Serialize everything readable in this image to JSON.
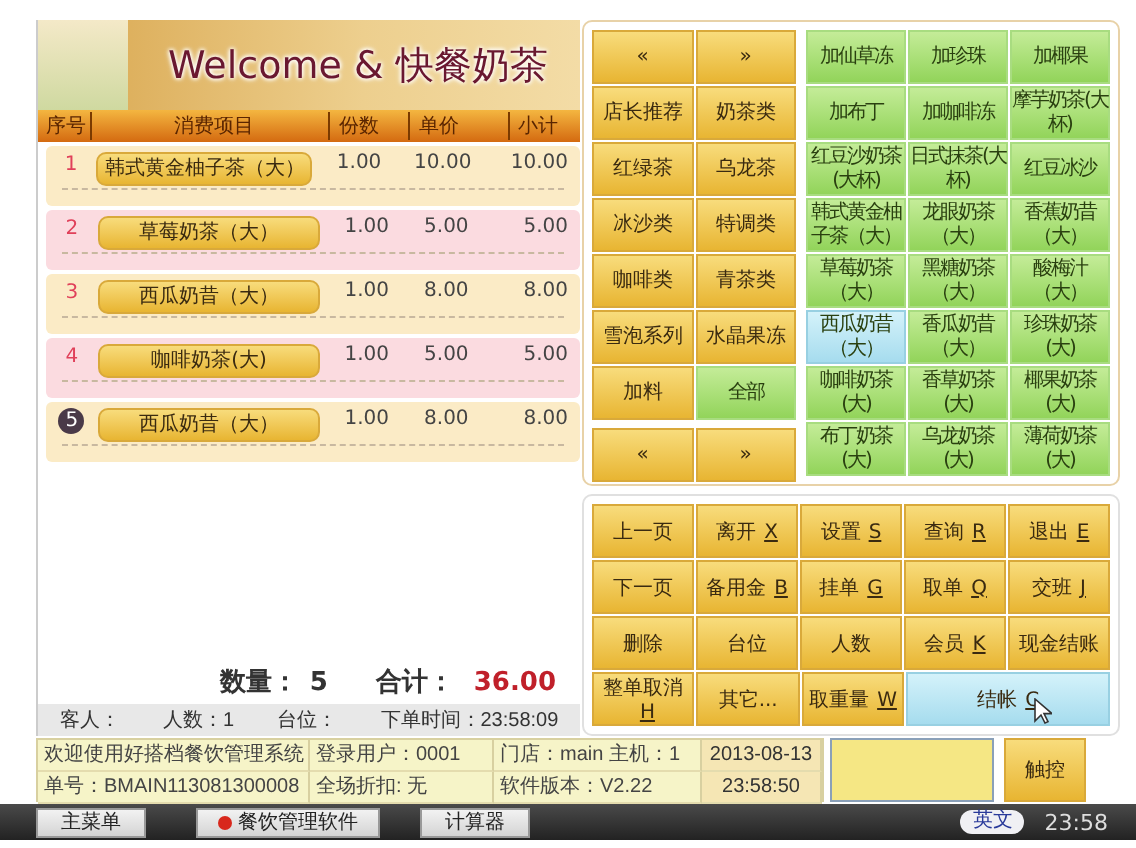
{
  "banner": {
    "title": "Welcome & 快餐奶茶"
  },
  "order": {
    "columns": [
      "序号",
      "消费项目",
      "份数",
      "单价",
      "小计"
    ],
    "rows": [
      {
        "index": "1",
        "item": "韩式黄金柚子茶（大）",
        "qty": "1.00",
        "price": "10.00",
        "subtotal": "10.00",
        "selected": false
      },
      {
        "index": "2",
        "item": "草莓奶茶（大）",
        "qty": "1.00",
        "price": "5.00",
        "subtotal": "5.00",
        "selected": false
      },
      {
        "index": "3",
        "item": "西瓜奶昔（大）",
        "qty": "1.00",
        "price": "8.00",
        "subtotal": "8.00",
        "selected": false
      },
      {
        "index": "4",
        "item": "咖啡奶茶(大)",
        "qty": "1.00",
        "price": "5.00",
        "subtotal": "5.00",
        "selected": false
      },
      {
        "index": "5",
        "item": "西瓜奶昔（大）",
        "qty": "1.00",
        "price": "8.00",
        "subtotal": "8.00",
        "selected": true
      }
    ]
  },
  "totals": {
    "quantity_label": "数量：",
    "quantity": "5",
    "total_label": "合计：",
    "total": "36.00"
  },
  "info": [
    "客人：",
    "人数：1",
    "台位：",
    "下单时间：23:58:09"
  ],
  "menu": {
    "nav_top": [
      "«",
      "»"
    ],
    "nav_bottom": [
      "«",
      "»"
    ],
    "categories": [
      {
        "label": "店长推荐",
        "selected": false
      },
      {
        "label": "奶茶类",
        "selected": false
      },
      {
        "label": "红绿茶",
        "selected": false
      },
      {
        "label": "乌龙茶",
        "selected": false
      },
      {
        "label": "冰沙类",
        "selected": false
      },
      {
        "label": "特调类",
        "selected": false
      },
      {
        "label": "咖啡类",
        "selected": false
      },
      {
        "label": "青茶类",
        "selected": false
      },
      {
        "label": "雪泡系列",
        "selected": false
      },
      {
        "label": "水晶果冻",
        "selected": false
      },
      {
        "label": "加料",
        "selected": false
      },
      {
        "label": "全部",
        "selected": true
      }
    ],
    "items": [
      {
        "label": "加仙草冻",
        "selected": false
      },
      {
        "label": "加珍珠",
        "selected": false
      },
      {
        "label": "加椰果",
        "selected": false
      },
      {
        "label": "加布丁",
        "selected": false
      },
      {
        "label": "加咖啡冻",
        "selected": false
      },
      {
        "label": "摩芋奶茶(大杯)",
        "selected": false
      },
      {
        "label": "红豆沙奶茶(大杯)",
        "selected": false
      },
      {
        "label": "日式抹茶(大杯)",
        "selected": false
      },
      {
        "label": "红豆冰沙",
        "selected": false
      },
      {
        "label": "韩式黄金柚子茶（大）",
        "selected": false
      },
      {
        "label": "龙眼奶茶（大）",
        "selected": false
      },
      {
        "label": "香蕉奶昔（大）",
        "selected": false
      },
      {
        "label": "草莓奶茶（大）",
        "selected": false
      },
      {
        "label": "黑糖奶茶（大）",
        "selected": false
      },
      {
        "label": "酸梅汁（大）",
        "selected": false
      },
      {
        "label": "西瓜奶昔（大）",
        "selected": true
      },
      {
        "label": "香瓜奶昔（大）",
        "selected": false
      },
      {
        "label": "珍珠奶茶(大)",
        "selected": false
      },
      {
        "label": "咖啡奶茶(大)",
        "selected": false
      },
      {
        "label": "香草奶茶(大)",
        "selected": false
      },
      {
        "label": "椰果奶茶(大)",
        "selected": false
      },
      {
        "label": "布丁奶茶(大)",
        "selected": false
      },
      {
        "label": "乌龙奶茶(大)",
        "selected": false
      },
      {
        "label": "薄荷奶茶(大)",
        "selected": false
      }
    ]
  },
  "functions": [
    [
      {
        "label": "上一页",
        "kind": "normal",
        "selected": false
      },
      {
        "label": "离开",
        "key": "X",
        "kind": "normal",
        "selected": false
      },
      {
        "label": "设置",
        "key": "S",
        "kind": "normal",
        "selected": false
      },
      {
        "label": "查询",
        "key": "R",
        "kind": "normal",
        "selected": false
      },
      {
        "label": "退出",
        "key": "E",
        "kind": "normal",
        "selected": false
      }
    ],
    [
      {
        "label": "下一页",
        "kind": "normal",
        "selected": false
      },
      {
        "label": "备用金",
        "key": "B",
        "kind": "normal",
        "selected": false
      },
      {
        "label": "挂单",
        "key": "G",
        "kind": "normal",
        "selected": false
      },
      {
        "label": "取单",
        "key": "Q",
        "kind": "normal",
        "selected": false
      },
      {
        "label": "交班",
        "key": "J",
        "kind": "normal",
        "selected": false
      }
    ],
    [
      {
        "label": "删除",
        "kind": "normal",
        "selected": false
      },
      {
        "label": "台位",
        "kind": "normal",
        "selected": false
      },
      {
        "label": "人数",
        "kind": "normal",
        "selected": false
      },
      {
        "label": "会员",
        "key": "K",
        "kind": "normal",
        "selected": false
      },
      {
        "label": "现金结账",
        "kind": "normal",
        "selected": false
      }
    ],
    [
      {
        "label": "整单取消",
        "key": "H",
        "kind": "normal",
        "selected": false
      },
      {
        "label": "其它...",
        "kind": "normal",
        "selected": false
      },
      {
        "label": "取重量",
        "key": "W",
        "kind": "normal",
        "selected": false
      },
      {
        "label": "结帐",
        "key": "C",
        "kind": "wide",
        "selected": true
      }
    ]
  ],
  "status": {
    "cells": [
      "欢迎使用好搭档餐饮管理系统",
      "登录用户：0001",
      "门店：main  主机：1",
      "2013-08-13",
      "单号：BMAIN113081300008",
      "全场折扣: 无",
      "软件版本：V2.22",
      "23:58:50"
    ],
    "touch_button": "触控"
  },
  "taskbar": {
    "buttons": [
      {
        "label": "主菜单",
        "kind": "plain"
      },
      {
        "label": "餐饮管理软件",
        "kind": "app"
      },
      {
        "label": "计算器",
        "kind": "plain"
      }
    ],
    "language": "英文",
    "clock": "23:58"
  }
}
